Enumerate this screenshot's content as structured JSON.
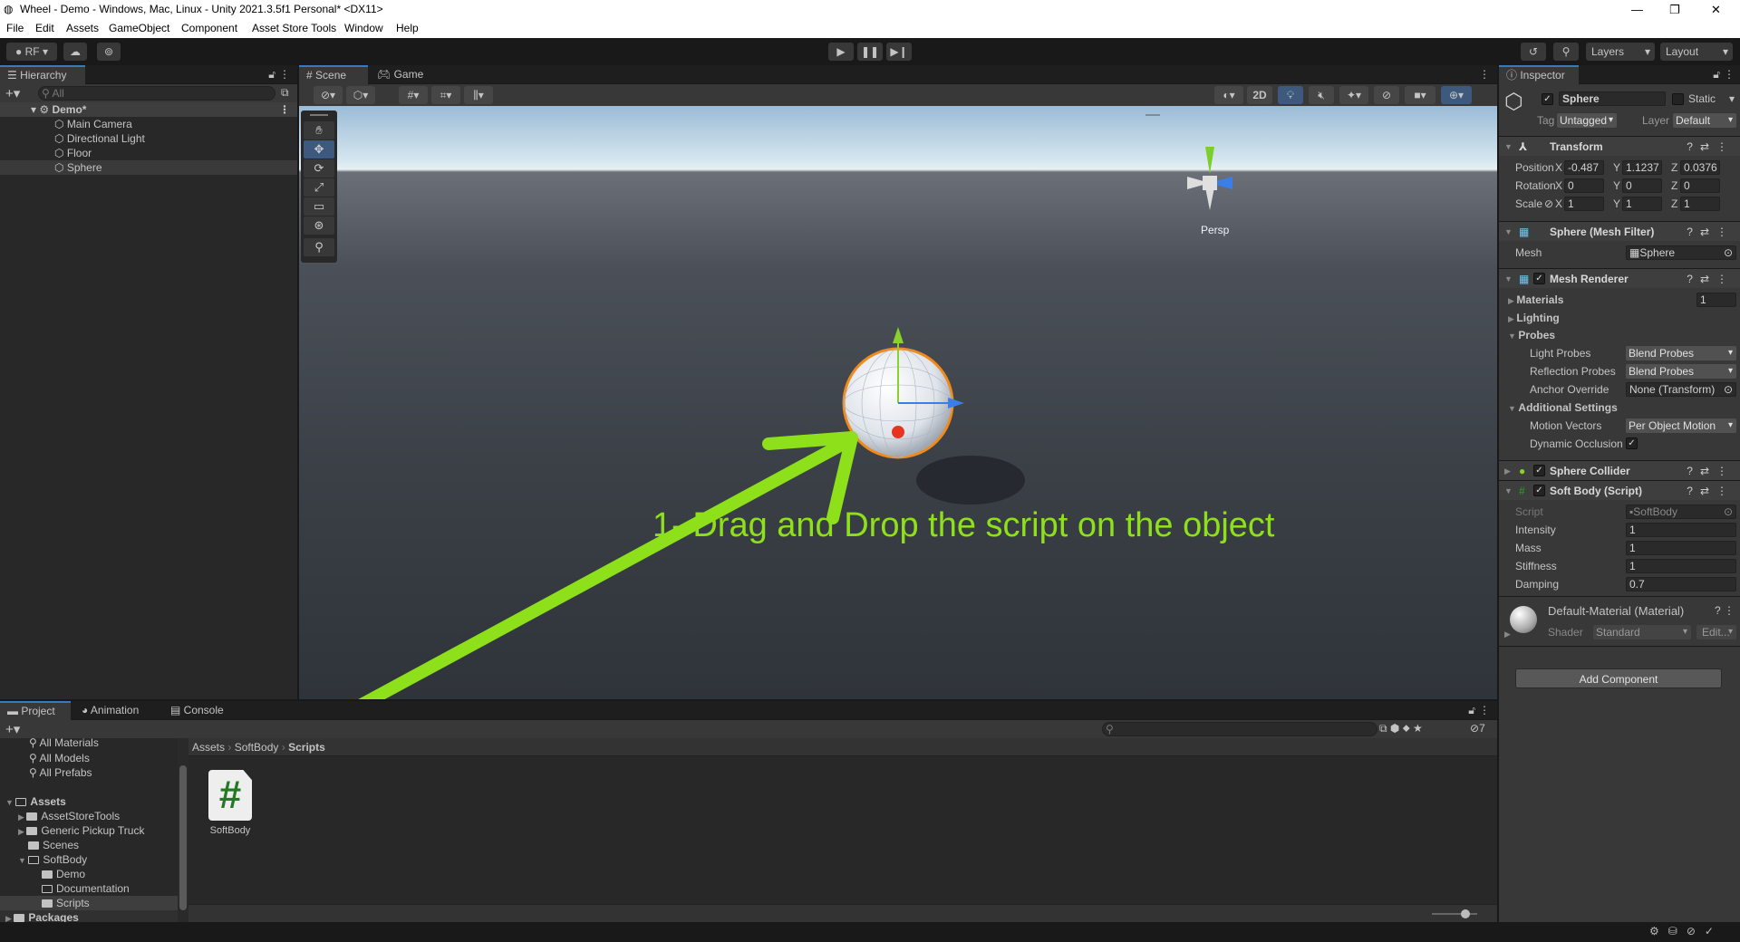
{
  "window": {
    "title": "Wheel - Demo - Windows, Mac, Linux - Unity 2021.3.5f1 Personal* <DX11>"
  },
  "menu": [
    "File",
    "Edit",
    "Assets",
    "GameObject",
    "Component",
    "Asset Store Tools",
    "Window",
    "Help"
  ],
  "toolbar": {
    "account": "RF",
    "layers": "Layers",
    "layout": "Layout"
  },
  "hierarchy": {
    "tab": "Hierarchy",
    "search_placeholder": "All",
    "scene": "Demo*",
    "items": [
      "Main Camera",
      "Directional Light",
      "Floor",
      "Sphere"
    ]
  },
  "scene": {
    "tabs": [
      "Scene",
      "Game"
    ],
    "btn_2d": "2D",
    "persp": "Persp",
    "annotation": "1- Drag and Drop the script on the object",
    "colors": {
      "annotation": "#8ee01a",
      "sky": "#c9dcea",
      "ground": "#3d4249"
    }
  },
  "inspector": {
    "tab": "Inspector",
    "name": "Sphere",
    "static": "Static",
    "tag_label": "Tag",
    "tag": "Untagged",
    "layer_label": "Layer",
    "layer": "Default",
    "transform": {
      "title": "Transform",
      "position_label": "Position",
      "rotation_label": "Rotation",
      "scale_label": "Scale",
      "position": [
        "-0.487",
        "1.1237",
        "0.0376"
      ],
      "rotation": [
        "0",
        "0",
        "0"
      ],
      "scale": [
        "1",
        "1",
        "1"
      ],
      "axes": [
        "X",
        "Y",
        "Z"
      ]
    },
    "mesh_filter": {
      "title": "Sphere (Mesh Filter)",
      "mesh_label": "Mesh",
      "mesh": "Sphere"
    },
    "mesh_renderer": {
      "title": "Mesh Renderer",
      "materials": "Materials",
      "materials_count": "1",
      "lighting": "Lighting",
      "probes": "Probes",
      "light_probes_label": "Light Probes",
      "light_probes": "Blend Probes",
      "reflection_probes_label": "Reflection Probes",
      "reflection_probes": "Blend Probes",
      "anchor_label": "Anchor Override",
      "anchor": "None (Transform)",
      "additional": "Additional Settings",
      "motion_label": "Motion Vectors",
      "motion": "Per Object Motion",
      "dynamic_label": "Dynamic Occlusion"
    },
    "sphere_collider": {
      "title": "Sphere Collider"
    },
    "soft_body": {
      "title": "Soft Body (Script)",
      "script_label": "Script",
      "script": "SoftBody",
      "fields": [
        {
          "label": "Intensity",
          "value": "1"
        },
        {
          "label": "Mass",
          "value": "1"
        },
        {
          "label": "Stiffness",
          "value": "1"
        },
        {
          "label": "Damping",
          "value": "0.7"
        }
      ]
    },
    "material": {
      "title": "Default-Material (Material)",
      "shader_label": "Shader",
      "shader": "Standard",
      "edit": "Edit..."
    },
    "add_component": "Add Component"
  },
  "project": {
    "tabs": [
      "Project",
      "Animation",
      "Console"
    ],
    "favorites": [
      "All Materials",
      "All Models",
      "All Prefabs"
    ],
    "assets": "Assets",
    "folders": [
      "AssetStoreTools",
      "Generic Pickup Truck",
      "Scenes",
      "SoftBody"
    ],
    "softbody_children": [
      "Demo",
      "Documentation",
      "Scripts"
    ],
    "packages": "Packages",
    "breadcrumb": [
      "Assets",
      "SoftBody",
      "Scripts"
    ],
    "file": "SoftBody",
    "hidden_count": "7"
  }
}
